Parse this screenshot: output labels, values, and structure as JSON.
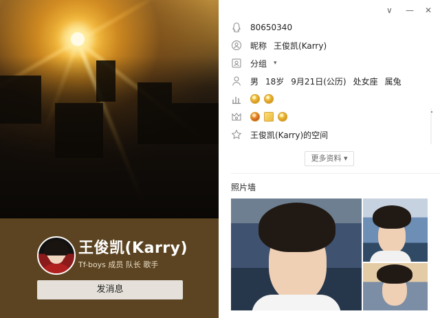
{
  "window": {
    "controls": {
      "dropdown": "∨",
      "minimize": "—",
      "close": "✕"
    }
  },
  "profile": {
    "name": "王俊凯(Karry)",
    "subtitle": "Tf-boys 成员 队长 歌手",
    "message_button": "发消息"
  },
  "details": {
    "qq_number": "80650340",
    "nickname_label": "昵称",
    "nickname": "王俊凯(Karry)",
    "group_label": "分组",
    "group_arrow": "▾",
    "gender": "男",
    "age": "18岁",
    "birthday": "9月21日(公历)",
    "zodiac": "处女座",
    "chinese_zodiac": "属兔",
    "space_link": "王俊凯(Karry)的空间",
    "more_button": "更多资料 ▾"
  },
  "photo_wall": {
    "title": "照片墙"
  },
  "icons": [
    "qq-icon",
    "nickname-icon",
    "group-icon",
    "person-icon",
    "level-icon",
    "vip-icon",
    "star-icon"
  ],
  "colors": {
    "left_panel": "#5c4422",
    "button_bg": "#e5e1da",
    "badge_gold": "#f2c44b"
  }
}
